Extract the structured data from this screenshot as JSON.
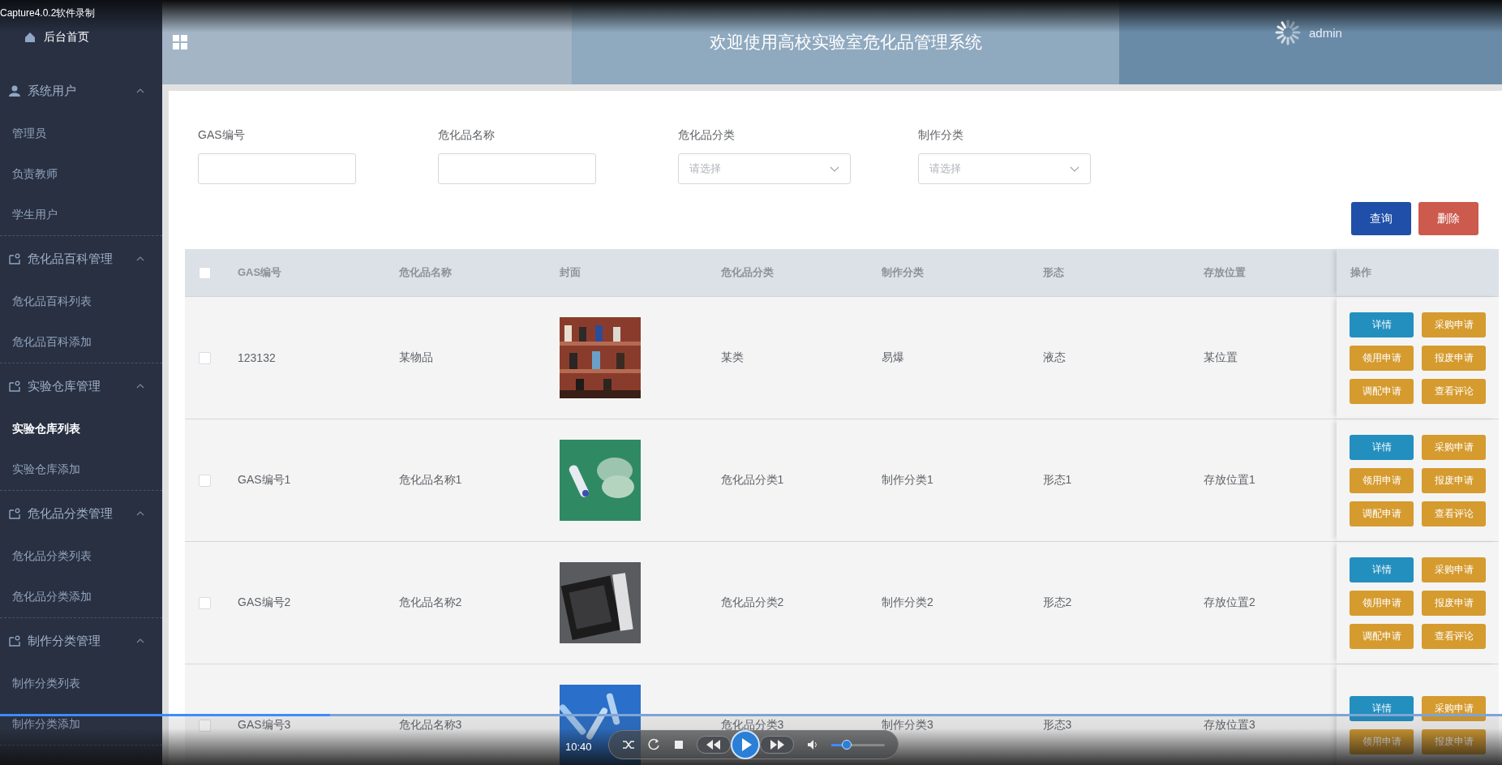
{
  "recorder_label": "Capture4.0.2软件录制",
  "sidebar": {
    "home": "后台首页",
    "groups": [
      {
        "title": "系统用户",
        "kind": "user",
        "expanded": true,
        "children": [
          {
            "label": "管理员",
            "selected": false
          },
          {
            "label": "负责教师",
            "selected": false
          },
          {
            "label": "学生用户",
            "selected": false
          }
        ]
      },
      {
        "title": "危化品百科管理",
        "kind": "module",
        "expanded": true,
        "children": [
          {
            "label": "危化品百科列表",
            "selected": false
          },
          {
            "label": "危化品百科添加",
            "selected": false
          }
        ]
      },
      {
        "title": "实验仓库管理",
        "kind": "module",
        "expanded": true,
        "children": [
          {
            "label": "实验仓库列表",
            "selected": true
          },
          {
            "label": "实验仓库添加",
            "selected": false
          }
        ]
      },
      {
        "title": "危化品分类管理",
        "kind": "module",
        "expanded": true,
        "children": [
          {
            "label": "危化品分类列表",
            "selected": false
          },
          {
            "label": "危化品分类添加",
            "selected": false
          }
        ]
      },
      {
        "title": "制作分类管理",
        "kind": "module",
        "expanded": true,
        "children": [
          {
            "label": "制作分类列表",
            "selected": false
          },
          {
            "label": "制作分类添加",
            "selected": false
          }
        ]
      }
    ]
  },
  "header": {
    "title": "欢迎使用高校实验室危化品管理系统",
    "user": "admin"
  },
  "filters": [
    {
      "label": "GAS编号",
      "kind": "text"
    },
    {
      "label": "危化品名称",
      "kind": "text"
    },
    {
      "label": "危化品分类",
      "kind": "select",
      "placeholder": "请选择"
    },
    {
      "label": "制作分类",
      "kind": "select",
      "placeholder": "请选择"
    }
  ],
  "buttons": [
    {
      "label": "查询",
      "kind": "primary"
    },
    {
      "label": "删除",
      "kind": "danger"
    }
  ],
  "table": {
    "all_checked": false,
    "columns": [
      "GAS编号",
      "危化品名称",
      "封面",
      "危化品分类",
      "制作分类",
      "形态",
      "存放位置",
      "操作"
    ],
    "rows": [
      {
        "checked": false,
        "cells": [
          "123132",
          "某物品",
          {
            "kind": "picture"
          },
          "某类",
          "易爆",
          "液态",
          "某位置"
        ],
        "actions": [
          {
            "label": "详情",
            "kind": "info"
          },
          {
            "label": "采购申请",
            "kind": "warn"
          },
          {
            "label": "领用申请",
            "kind": "warn"
          },
          {
            "label": "报废申请",
            "kind": "warn"
          },
          {
            "label": "调配申请",
            "kind": "warn"
          },
          {
            "label": "查看评论",
            "kind": "warn"
          }
        ]
      },
      {
        "checked": false,
        "cells": [
          "GAS编号1",
          "危化品名称1",
          {
            "kind": "picture"
          },
          "危化品分类1",
          "制作分类1",
          "形态1",
          "存放位置1"
        ],
        "actions": [
          {
            "label": "详情",
            "kind": "info"
          },
          {
            "label": "采购申请",
            "kind": "warn"
          },
          {
            "label": "领用申请",
            "kind": "warn"
          },
          {
            "label": "报废申请",
            "kind": "warn"
          },
          {
            "label": "调配申请",
            "kind": "warn"
          },
          {
            "label": "查看评论",
            "kind": "warn"
          }
        ]
      },
      {
        "checked": false,
        "cells": [
          "GAS编号2",
          "危化品名称2",
          {
            "kind": "picture"
          },
          "危化品分类2",
          "制作分类2",
          "形态2",
          "存放位置2"
        ],
        "actions": [
          {
            "label": "详情",
            "kind": "info"
          },
          {
            "label": "采购申请",
            "kind": "warn"
          },
          {
            "label": "领用申请",
            "kind": "warn"
          },
          {
            "label": "报废申请",
            "kind": "warn"
          },
          {
            "label": "调配申请",
            "kind": "warn"
          },
          {
            "label": "查看评论",
            "kind": "warn"
          }
        ]
      },
      {
        "checked": false,
        "cells": [
          "GAS编号3",
          "危化品名称3",
          {
            "kind": "picture"
          },
          "危化品分类3",
          "制作分类3",
          "形态3",
          "存放位置3"
        ],
        "actions": [
          {
            "label": "详情",
            "kind": "info"
          },
          {
            "label": "采购申请",
            "kind": "warn"
          },
          {
            "label": "领用申请",
            "kind": "warn"
          },
          {
            "label": "报废申请",
            "kind": "warn"
          }
        ]
      }
    ]
  },
  "player": {
    "time": "10:40",
    "progress": {
      "level": 0.22
    },
    "volume": {
      "level": 0.3
    }
  }
}
